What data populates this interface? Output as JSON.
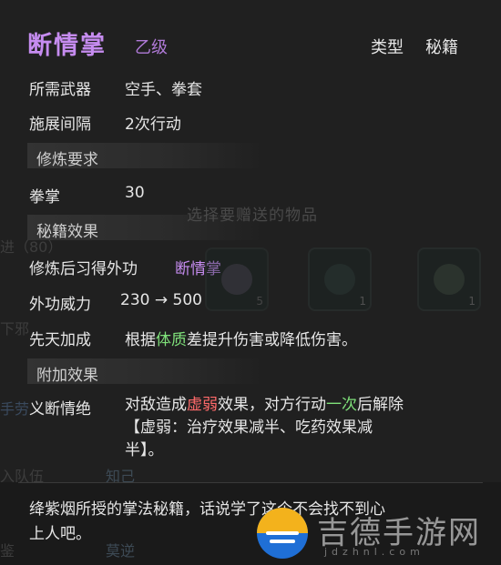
{
  "tooltip": {
    "name": "断情掌",
    "grade": "乙级",
    "type_label": "类型",
    "type_value": "秘籍",
    "weapon_label": "所需武器",
    "weapon_value": "空手、拳套",
    "interval_label": "施展间隔",
    "interval_value": "2次行动",
    "section_requirements": "修炼要求",
    "req_label": "拳掌",
    "req_value": "30",
    "section_effects": "秘籍效果",
    "learn_label": "修炼后习得外功",
    "learn_value": "断情掌",
    "power_label": "外功威力",
    "power_value": "230 → 500",
    "innate_label": "先天加成",
    "innate_pre": "根据",
    "innate_attr": "体质",
    "innate_post": "差提升伤害或降低伤害。",
    "section_extra": "附加效果",
    "extra_label": "义断情绝",
    "extra_line1_a": "对敌造成",
    "extra_line1_b": "虚弱",
    "extra_line1_c": "效果，对方行动",
    "extra_line1_d": "一次",
    "extra_line1_e": "后解除",
    "extra_line2": "【虚弱：治疗效果减半、吃药效果减",
    "extra_line3": "半】。",
    "flavor_line1": "绛紫烟所授的掌法秘籍，话说学了这个不会找不到心",
    "flavor_line2": "上人吧。"
  },
  "background": {
    "gift_title": "选择要赠送的物品",
    "slots": [
      {
        "icon": "orb-icon",
        "count": "5"
      },
      {
        "icon": "beetle-icon",
        "count": "1"
      },
      {
        "icon": "scroll-icon",
        "count": "1"
      },
      {
        "icon": "scroll-icon",
        "count": ""
      }
    ],
    "left_fragments": [
      "进（80）",
      "下邪",
      "手劳",
      "入队伍",
      "鉴"
    ],
    "right_fragments": [
      "知己",
      "莫逆"
    ]
  },
  "watermark": {
    "text": "吉德手游网",
    "sub": "jdzhnl.com"
  },
  "colors": {
    "accent_purple": "#c68cf0",
    "highlight_green": "#7fe07a",
    "highlight_red": "#ff6a6a"
  }
}
